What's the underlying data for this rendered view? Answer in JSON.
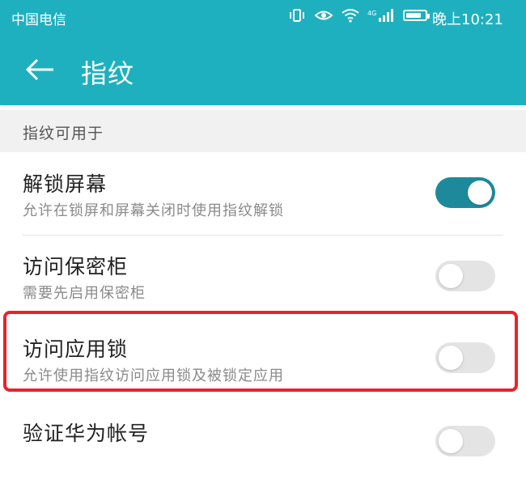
{
  "status_bar": {
    "carrier": "中国电信",
    "network_label": "4G",
    "time": "晚上10:21",
    "battery_level_percent": 80
  },
  "app_bar": {
    "title": "指纹"
  },
  "section": {
    "header": "指纹可用于"
  },
  "settings": [
    {
      "title": "解锁屏幕",
      "subtitle": "允许在锁屏和屏幕关闭时使用指纹解锁",
      "enabled": true
    },
    {
      "title": "访问保密柜",
      "subtitle": "需要先启用保密柜",
      "enabled": false
    },
    {
      "title": "访问应用锁",
      "subtitle": "允许使用指纹访问应用锁及被锁定应用",
      "enabled": false
    },
    {
      "title": "验证华为帐号",
      "subtitle": "",
      "enabled": false
    }
  ],
  "colors": {
    "accent": "#1fb0bf",
    "toggle_on": "#1d8a9c",
    "toggle_off": "#e4e4e4",
    "highlight": "#e8232a"
  }
}
